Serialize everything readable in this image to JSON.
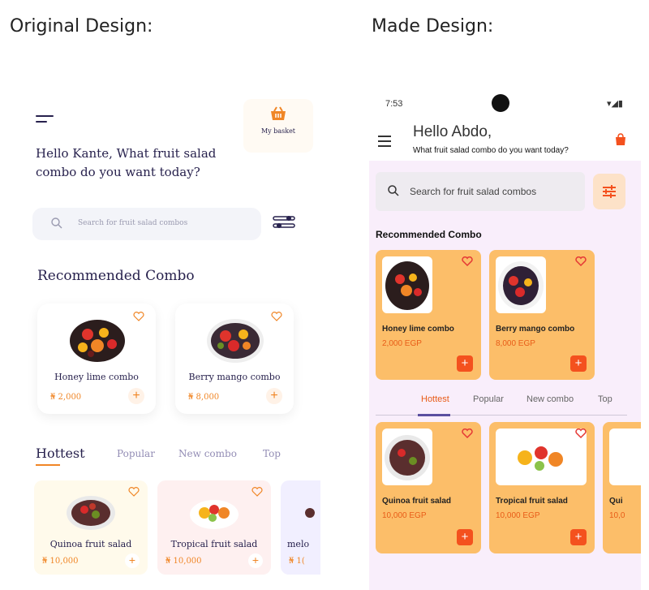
{
  "headings": {
    "original": "Original Design:",
    "made": "Made Design:"
  },
  "original": {
    "basket_label": "My basket",
    "greeting": "Hello Kante, What fruit salad combo do you want today?",
    "search_placeholder": "Search for fruit salad combos",
    "recommended_title": "Recommended Combo",
    "recommended": [
      {
        "name": "Honey lime combo",
        "price": "₦ 2,000"
      },
      {
        "name": "Berry mango combo",
        "price": "₦ 8,000"
      }
    ],
    "tabs": [
      "Hottest",
      "Popular",
      "New combo",
      "Top"
    ],
    "hottest": [
      {
        "name": "Quinoa fruit salad",
        "price": "₦ 10,000",
        "bg": "#fffaeb"
      },
      {
        "name": "Tropical fruit salad",
        "price": "₦ 10,000",
        "bg": "#fef0f0"
      },
      {
        "name": "melo",
        "price": "₦ 1(",
        "bg": "#f1efff"
      }
    ],
    "accent": "#f08626"
  },
  "made": {
    "status": {
      "time": "7:53"
    },
    "hello": "Hello Abdo,",
    "subtitle": "What fruit salad combo do you want today?",
    "search_placeholder": "Search for fruit salad combos",
    "recommended_title": "Recommended Combo",
    "recommended": [
      {
        "name": "Honey lime combo",
        "price": "2,000 EGP"
      },
      {
        "name": "Berry mango combo",
        "price": "8,000 EGP"
      }
    ],
    "tabs": [
      "Hottest",
      "Popular",
      "New combo",
      "Top"
    ],
    "hottest": [
      {
        "name": "Quinoa fruit salad",
        "price": "10,000 EGP"
      },
      {
        "name": "Tropical fruit salad",
        "price": "10,000 EGP"
      },
      {
        "name": "Qui",
        "price": "10,0"
      }
    ],
    "accent": "#f4511e",
    "card_color": "#fcbe69"
  }
}
